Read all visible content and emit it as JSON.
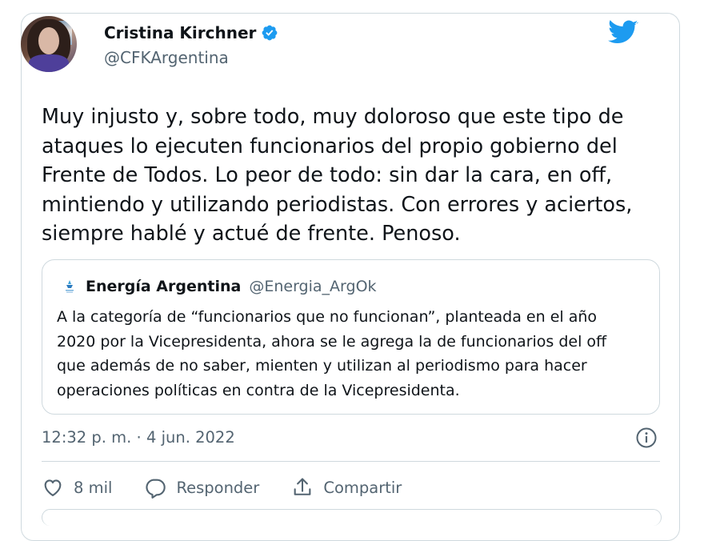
{
  "author": {
    "name": "Cristina Kirchner",
    "handle": "@CFKArgentina"
  },
  "tweet": {
    "text": "Muy injusto y, sobre todo, muy doloroso que este tipo de\nataques lo ejecuten funcionarios del propio gobierno del\nFrente de Todos. Lo peor de todo: sin dar la cara, en off,\nmintiendo y utilizando periodistas. Con errores y aciertos,\nsiempre hablé y actué de frente. Penoso.",
    "timestamp": "12:32 p. m. · 4 jun. 2022"
  },
  "quoted": {
    "name": "Energía Argentina",
    "handle": "@Energia_ArgOk",
    "text": "A la categoría de “funcionarios que no funcionan”, planteada en el año\n2020 por la Vicepresidenta, ahora se le agrega la de funcionarios del off\nque además de no saber, mienten y utilizan al periodismo para hacer\noperaciones políticas en contra de la Vicepresidenta."
  },
  "actions": {
    "like_count": "8 mil",
    "reply_label": "Responder",
    "share_label": "Compartir"
  },
  "icons": {
    "brand": "twitter-bird-icon",
    "verified": "verified-badge-icon",
    "info": "info-icon",
    "like": "heart-icon",
    "reply": "speech-bubble-icon",
    "share": "share-upload-icon"
  },
  "colors": {
    "accent": "#1d9bf0",
    "text": "#0f1419",
    "muted": "#536471",
    "border": "#cfd9de"
  }
}
